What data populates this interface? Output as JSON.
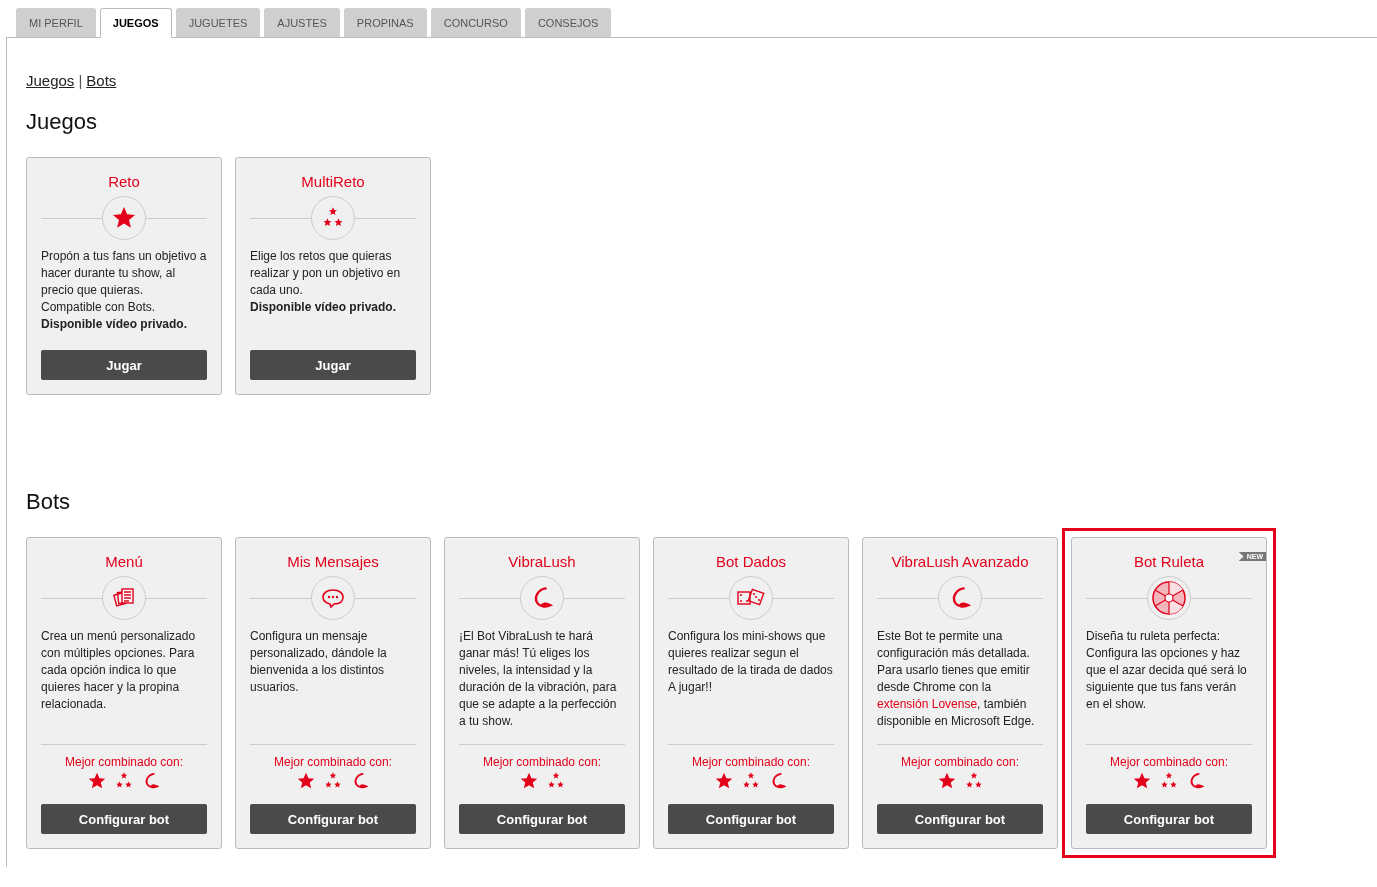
{
  "tabs": [
    {
      "label": "MI PERFIL",
      "selected": false
    },
    {
      "label": "JUEGOS",
      "selected": true
    },
    {
      "label": "JUGUETES",
      "selected": false
    },
    {
      "label": "AJUSTES",
      "selected": false
    },
    {
      "label": "PROPINAS",
      "selected": false
    },
    {
      "label": "CONCURSO",
      "selected": false
    },
    {
      "label": "CONSEJOS",
      "selected": false
    }
  ],
  "breadcrumb": {
    "links": [
      "Juegos",
      "Bots"
    ],
    "separator": "|"
  },
  "sections": [
    {
      "title": "Juegos",
      "cards": [
        {
          "title": "Reto",
          "kind": "star",
          "description": [
            {
              "kind": "text",
              "text": "Propón a tus fans un objetivo a hacer durante tu show, al precio que quieras. Compatible con Bots."
            }
          ],
          "note": "Disponible vídeo privado.",
          "button": "Jugar",
          "highlighted": false
        },
        {
          "title": "MultiReto",
          "kind": "stars",
          "description": [
            {
              "kind": "text",
              "text": "Elige los retos que quieras realizar y pon un objetivo en cada uno."
            }
          ],
          "note": "Disponible vídeo privado.",
          "button": "Jugar",
          "highlighted": false
        }
      ]
    },
    {
      "title": "Bots",
      "cards": [
        {
          "title": "Menú",
          "kind": "menu",
          "description": [
            {
              "kind": "text",
              "text": "Crea un menú personalizado con múltiples opciones. Para cada opción indica lo que quieres hacer y la propina relacionada."
            }
          ],
          "combo_label": "Mejor combinado con:",
          "combo": [
            {
              "kind": "star"
            },
            {
              "kind": "stars"
            },
            {
              "kind": "lush"
            }
          ],
          "button": "Configurar bot",
          "highlighted": false
        },
        {
          "title": "Mis Mensajes",
          "kind": "chat",
          "description": [
            {
              "kind": "text",
              "text": "Configura un mensaje personalizado, dándole la bienvenida a los distintos usuarios."
            }
          ],
          "combo_label": "Mejor combinado con:",
          "combo": [
            {
              "kind": "star"
            },
            {
              "kind": "stars"
            },
            {
              "kind": "lush"
            }
          ],
          "button": "Configurar bot",
          "highlighted": false
        },
        {
          "title": "VibraLush",
          "kind": "lush",
          "description": [
            {
              "kind": "text",
              "text": "¡El Bot VibraLush te hará ganar más! Tú eliges los niveles, la intensidad y la duración de la vibración, para que se adapte a la perfección a tu show."
            }
          ],
          "combo_label": "Mejor combinado con:",
          "combo": [
            {
              "kind": "star"
            },
            {
              "kind": "stars"
            }
          ],
          "button": "Configurar bot",
          "highlighted": false
        },
        {
          "title": "Bot Dados",
          "kind": "dice",
          "description": [
            {
              "kind": "text",
              "text": "Configura los mini-shows que quieres realizar segun el resultado de la tirada de dados A jugar!!"
            }
          ],
          "combo_label": "Mejor combinado con:",
          "combo": [
            {
              "kind": "star"
            },
            {
              "kind": "stars"
            },
            {
              "kind": "lush"
            }
          ],
          "button": "Configurar bot",
          "highlighted": false
        },
        {
          "title": "VibraLush Avanzado",
          "kind": "lush",
          "description": [
            {
              "kind": "text",
              "text": "Este Bot te permite una configuración más detallada. Para usarlo tienes que emitir desde Chrome con la "
            },
            {
              "kind": "link",
              "text": "extensión Lovense"
            },
            {
              "kind": "text",
              "text": ", también disponible en Microsoft Edge."
            }
          ],
          "combo_label": "Mejor combinado con:",
          "combo": [
            {
              "kind": "star"
            },
            {
              "kind": "stars"
            }
          ],
          "button": "Configurar bot",
          "highlighted": false
        },
        {
          "title": "Bot Ruleta",
          "kind": "wheel",
          "badge": "NEW",
          "description": [
            {
              "kind": "text",
              "text": "Diseña tu ruleta perfecta: Configura las opciones y haz que el azar decida qué será lo siguiente que tus fans verán en el show."
            }
          ],
          "combo_label": "Mejor combinado con:",
          "combo": [
            {
              "kind": "star"
            },
            {
              "kind": "stars"
            },
            {
              "kind": "lush"
            }
          ],
          "button": "Configurar bot",
          "highlighted": true
        }
      ]
    }
  ]
}
